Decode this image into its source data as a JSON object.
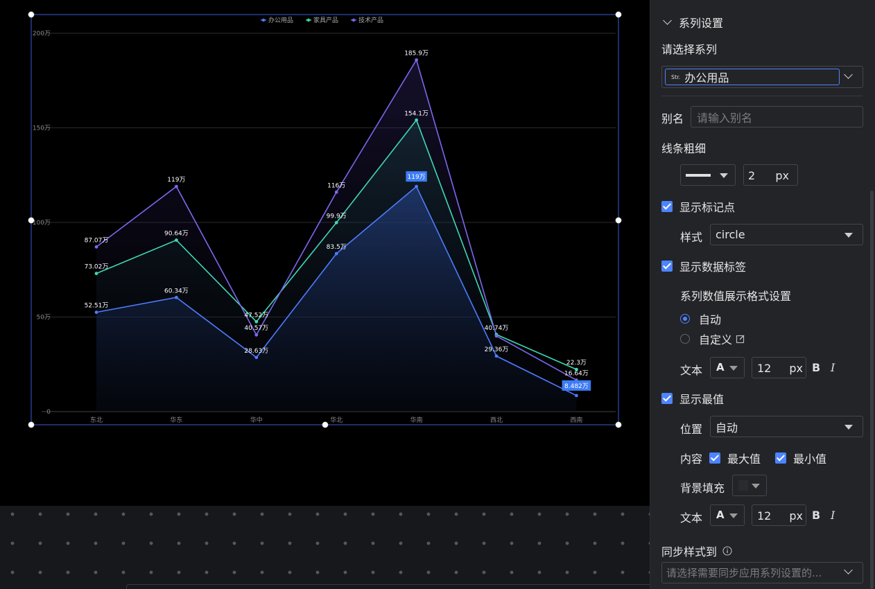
{
  "chart_data": {
    "type": "area",
    "categories": [
      "东北",
      "华东",
      "华中",
      "华北",
      "华南",
      "西北",
      "西南"
    ],
    "ylim": [
      0,
      2000000
    ],
    "yticks": [
      "0",
      "50万",
      "100万",
      "150万",
      "200万"
    ],
    "ytick_values": [
      0,
      500000,
      1000000,
      1500000,
      2000000
    ],
    "grid": true,
    "legend_position": "top-center",
    "series": [
      {
        "name": "办公用品",
        "color": "#4d7cff",
        "values": [
          525100,
          603400,
          286300,
          835000,
          1190000,
          293600,
          84820
        ],
        "labels": [
          "52.51万",
          "60.34万",
          "28.63万",
          "83.5万",
          "119万",
          "29.36万",
          "8.482万"
        ]
      },
      {
        "name": "家具产品",
        "color": "#3fd9b2",
        "values": [
          730200,
          906400,
          475200,
          999000,
          1541000,
          407400,
          223000
        ],
        "labels": [
          "73.02万",
          "90.64万",
          "47.52万",
          "99.9万",
          "154.1万",
          "40.74万",
          "22.3万"
        ]
      },
      {
        "name": "技术产品",
        "color": "#7b68ee",
        "values": [
          870700,
          1190000,
          405700,
          1160000,
          1859000,
          400000,
          166400
        ],
        "labels": [
          "87.07万",
          "119万",
          "40.57万",
          "116万",
          "185.9万",
          "",
          "16.64万"
        ]
      }
    ],
    "highlight": [
      {
        "series": 0,
        "index": 4,
        "type": "max"
      },
      {
        "series": 0,
        "index": 6,
        "type": "min"
      }
    ],
    "accent_color": "#3d7cf5"
  },
  "panel": {
    "section_title": "系列设置",
    "select_series_label": "请选择系列",
    "series_select": {
      "badge": "Str.",
      "value": "办公用品"
    },
    "alias_label": "别名",
    "alias_placeholder": "请输入别名",
    "line_width_label": "线条粗细",
    "line_width_value": "2",
    "px": "px",
    "show_marker_label": "显示标记点",
    "marker_style_label": "样式",
    "marker_style_value": "circle",
    "show_data_label": "显示数据标签",
    "format_label": "系列数值展示格式设置",
    "format_auto": "自动",
    "format_custom": "自定义",
    "text_label": "文本",
    "font_icon": "A",
    "font_size": "12",
    "bold": "B",
    "italic": "I",
    "show_extreme_label": "显示最值",
    "position_label": "位置",
    "position_value": "自动",
    "content_label": "内容",
    "max_label": "最大值",
    "min_label": "最小值",
    "bg_fill_label": "背景填充",
    "text_label2": "文本",
    "font_size2": "12",
    "sync_label": "同步样式到",
    "sync_placeholder": "请选择需要同步应用系列设置的..."
  }
}
